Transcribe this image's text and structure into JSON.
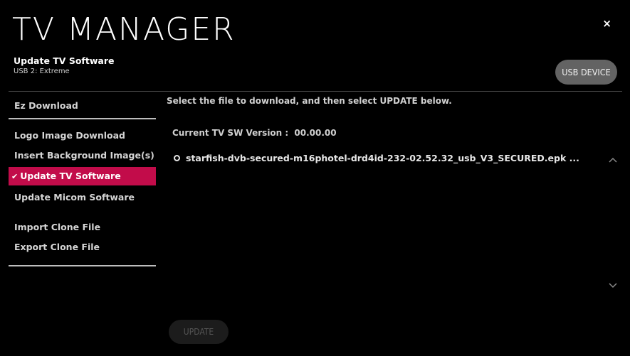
{
  "header": {
    "title": "TV MANAGER",
    "subtitle": "Update TV Software",
    "device": "USB 2: Extreme",
    "close_label": "×",
    "usb_button_label": "USB DEVICE"
  },
  "sidebar": {
    "items": [
      {
        "label": "Ez Download",
        "active": false
      },
      {
        "label": "Logo Image Download",
        "active": false
      },
      {
        "label": "Insert Background Image(s)",
        "active": false
      },
      {
        "label": "Update TV Software",
        "active": true,
        "check": "✔"
      },
      {
        "label": "Update Micom Software",
        "active": false
      },
      {
        "label": "Import Clone File",
        "active": false
      },
      {
        "label": "Export Clone File",
        "active": false
      }
    ]
  },
  "main": {
    "instruction": "Select the file to download, and then select UPDATE below.",
    "version_label": "Current TV SW Version :",
    "version_value": "00.00.00",
    "files": [
      {
        "name": "starfish-dvb-secured-m16photel-drd4id-232-02.52.32_usb_V3_SECURED.epk ...",
        "selected": false
      }
    ],
    "update_button_label": "UPDATE"
  },
  "colors": {
    "background": "#000000",
    "accent": "#c20c4a",
    "button": "#636363"
  },
  "icons": [
    "close-icon",
    "check-icon",
    "radio-icon",
    "chevron-up-icon",
    "chevron-down-icon"
  ]
}
